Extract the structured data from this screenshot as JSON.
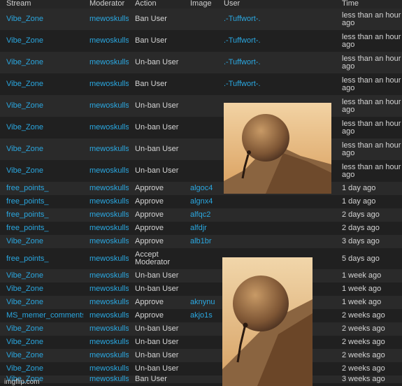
{
  "headers": [
    "Stream",
    "Moderator",
    "Action",
    "Image",
    "User",
    "Time"
  ],
  "rows": [
    {
      "stream": "Vibe_Zone",
      "moderator": "mewoskulls",
      "action": "Ban User",
      "image": "",
      "user": ".-Tuffwort-.",
      "time": "less than an hour ago"
    },
    {
      "stream": "Vibe_Zone",
      "moderator": "mewoskulls",
      "action": "Ban User",
      "image": "",
      "user": ".-Tuffwort-.",
      "time": "less than an hour ago"
    },
    {
      "stream": "Vibe_Zone",
      "moderator": "mewoskulls",
      "action": "Un-ban User",
      "image": "",
      "user": ".-Tuffwort-.",
      "time": "less than an hour ago"
    },
    {
      "stream": "Vibe_Zone",
      "moderator": "mewoskulls",
      "action": "Ban User",
      "image": "",
      "user": ".-Tuffwort-.",
      "time": "less than an hour ago"
    },
    {
      "stream": "Vibe_Zone",
      "moderator": "mewoskulls",
      "action": "Un-ban User",
      "image": "",
      "user": "",
      "time": "less than an hour ago"
    },
    {
      "stream": "Vibe_Zone",
      "moderator": "mewoskulls",
      "action": "Un-ban User",
      "image": "",
      "user": "",
      "time": "less than an hour ago"
    },
    {
      "stream": "Vibe_Zone",
      "moderator": "mewoskulls",
      "action": "Un-ban User",
      "image": "",
      "user": "",
      "time": "less than an hour ago"
    },
    {
      "stream": "Vibe_Zone",
      "moderator": "mewoskulls",
      "action": "Un-ban User",
      "image": "",
      "user": "",
      "time": "less than an hour ago"
    },
    {
      "stream": "free_points_",
      "moderator": "mewoskulls",
      "action": "Approve",
      "image": "algoc4",
      "user": "",
      "time": "1 day ago"
    },
    {
      "stream": "free_points_",
      "moderator": "mewoskulls",
      "action": "Approve",
      "image": "algnx4",
      "user": "",
      "time": "1 day ago"
    },
    {
      "stream": "free_points_",
      "moderator": "mewoskulls",
      "action": "Approve",
      "image": "alfqc2",
      "user": "",
      "time": "2 days ago"
    },
    {
      "stream": "free_points_",
      "moderator": "mewoskulls",
      "action": "Approve",
      "image": "alfdjr",
      "user": "",
      "time": "2 days ago"
    },
    {
      "stream": "Vibe_Zone",
      "moderator": "mewoskulls",
      "action": "Approve",
      "image": "alb1br",
      "user": "",
      "time": "3 days ago"
    },
    {
      "stream": "free_points_",
      "moderator": "mewoskulls",
      "action": "Accept Moderator",
      "image": "",
      "user": "",
      "time": "5 days ago"
    },
    {
      "stream": "Vibe_Zone",
      "moderator": "mewoskulls",
      "action": "Un-ban User",
      "image": "",
      "user": "",
      "time": "1 week ago"
    },
    {
      "stream": "Vibe_Zone",
      "moderator": "mewoskulls",
      "action": "Un-ban User",
      "image": "",
      "user": "",
      "time": "1 week ago"
    },
    {
      "stream": "Vibe_Zone",
      "moderator": "mewoskulls",
      "action": "Approve",
      "image": "aknynu",
      "user": "",
      "time": "1 week ago"
    },
    {
      "stream": "MS_memer_comments",
      "moderator": "mewoskulls",
      "action": "Approve",
      "image": "akjo1s",
      "user": "",
      "time": "2 weeks ago"
    },
    {
      "stream": "Vibe_Zone",
      "moderator": "mewoskulls",
      "action": "Un-ban User",
      "image": "",
      "user": "",
      "time": "2 weeks ago"
    },
    {
      "stream": "Vibe_Zone",
      "moderator": "mewoskulls",
      "action": "Un-ban User",
      "image": "",
      "user": "",
      "time": "2 weeks ago"
    },
    {
      "stream": "Vibe_Zone",
      "moderator": "mewoskulls",
      "action": "Un-ban User",
      "image": "",
      "user": "",
      "time": "2 weeks ago"
    },
    {
      "stream": "Vibe_Zone",
      "moderator": "mewoskulls",
      "action": "Un-ban User",
      "image": "",
      "user": "",
      "time": "2 weeks ago"
    },
    {
      "stream": "Vibe_Zone",
      "moderator": "mewoskulls",
      "action": "Ban User",
      "image": "",
      "user": "",
      "time": "3 weeks ago"
    }
  ],
  "watermark": "imgflip.com",
  "colors": {
    "link": "#2aa7e0",
    "row_odd": "#2a2a2a",
    "row_even": "#202020",
    "text": "#d4d4d4"
  }
}
